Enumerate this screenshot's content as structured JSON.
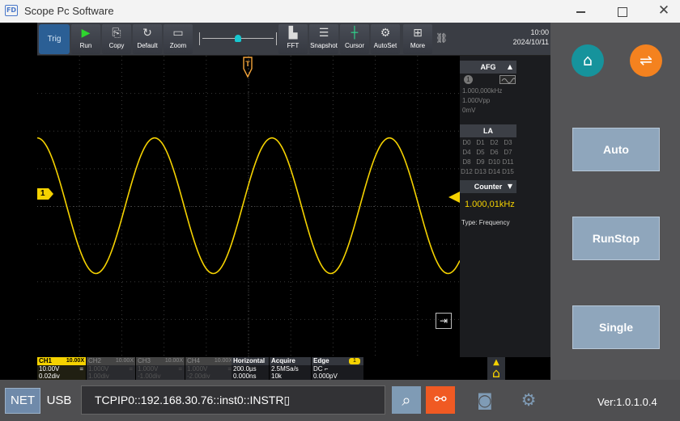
{
  "titlebar": {
    "logo": "FD",
    "title": "Scope Pc Software",
    "close_glyph": "✕"
  },
  "toolbar": {
    "trig": "Trig",
    "buttons": [
      {
        "id": "run",
        "label": "Run",
        "icon": "▶"
      },
      {
        "id": "copy",
        "label": "Copy",
        "icon": "⎘"
      },
      {
        "id": "default",
        "label": "Default",
        "icon": "↻"
      },
      {
        "id": "zoom",
        "label": "Zoom",
        "icon": "▭"
      },
      {
        "id": "fft",
        "label": "FFT",
        "icon": "▙"
      },
      {
        "id": "snapshot",
        "label": "Snapshot",
        "icon": "☰"
      },
      {
        "id": "cursor",
        "label": "Cursor",
        "icon": "┼"
      },
      {
        "id": "autoset",
        "label": "AutoSet",
        "icon": "⚙"
      },
      {
        "id": "more",
        "label": "More",
        "icon": "⊞"
      }
    ],
    "network_icon": "⛓",
    "time": "10:00",
    "date": "2024/10/11"
  },
  "screen": {
    "trigger_label": "T",
    "ch1_marker": "1",
    "exit_icon": "⇥"
  },
  "afg": {
    "title": "AFG",
    "arrow": "▲",
    "channel": "1",
    "freq": "1.000,000kHz",
    "amp": "1.000Vpp",
    "offset": "0mV"
  },
  "la": {
    "title": "LA",
    "channels": [
      "D0",
      "D1",
      "D2",
      "D3",
      "D4",
      "D5",
      "D6",
      "D7",
      "D8",
      "D9",
      "D10",
      "D11",
      "D12",
      "D13",
      "D14",
      "D15"
    ]
  },
  "counter": {
    "title": "Counter",
    "arrow": "▼",
    "value": "1.000,01kHz",
    "type_label": "Type: Frequency"
  },
  "channels": [
    {
      "name": "CH1",
      "probe": "10.00X",
      "scale": "10.00V",
      "coupling": "=",
      "offset": "0.02div"
    },
    {
      "name": "CH2",
      "probe": "10.00X",
      "scale": "1.000V",
      "coupling": "=",
      "offset": "1.00div"
    },
    {
      "name": "CH3",
      "probe": "10.00X",
      "scale": "1.000V",
      "coupling": "=",
      "offset": "-1.00div"
    },
    {
      "name": "CH4",
      "probe": "10.00X",
      "scale": "1.000V",
      "coupling": "=",
      "offset": "-2.00div"
    }
  ],
  "horizontal": {
    "title": "Horizontal",
    "timebase": "200.0µs",
    "delay": "0.000ns"
  },
  "acquire": {
    "title": "Acquire",
    "rate": "2.5MSa/s",
    "depth": "10k"
  },
  "edge": {
    "title": "Edge",
    "badge": "1",
    "coupling": "DC ⌐",
    "level": "0.000pV"
  },
  "right_panel": {
    "home_icon": "⌂",
    "remote_icon": "⇌",
    "auto": "Auto",
    "runstop": "RunStop",
    "single": "Single",
    "small_home_icon": "▲\n⌂"
  },
  "bottom": {
    "net": "NET",
    "usb": "USB",
    "address": "TCPIP0::192.168.30.76::inst0::INSTR▯",
    "search_icon": "⌕",
    "link_icon": "⚯",
    "camera_icon": "◙",
    "settings_icon": "⚙",
    "version": "Ver:1.0.1.0.4"
  },
  "colors": {
    "ch1": "#f5d200",
    "accent_teal": "#16939c",
    "accent_orange": "#f4821f",
    "button_blue": "#8fa6bc"
  },
  "waveform": {
    "type": "sine",
    "cycles": 3.6,
    "amplitude_div": 1.8,
    "offset_div": 0.02
  }
}
